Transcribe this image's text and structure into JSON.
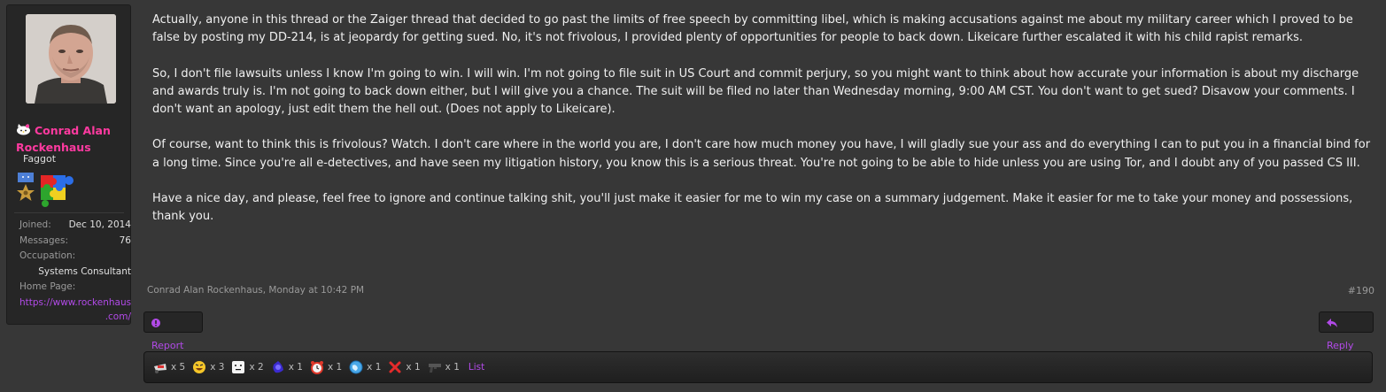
{
  "user": {
    "name": "Conrad Alan Rockenhaus",
    "title": "Faggot",
    "info": {
      "joined_label": "Joined:",
      "joined_value": "Dec 10, 2014",
      "messages_label": "Messages:",
      "messages_value": "76",
      "occupation_label": "Occupation:",
      "occupation_value": "Systems Consultant",
      "homepage_label": "Home Page:",
      "homepage_line1": "https://www.rockenhaus",
      "homepage_line2": ".com/"
    }
  },
  "message": {
    "paragraphs": [
      "Actually, anyone in this thread or the Zaiger thread that decided to go past the limits of free speech by committing libel, which is making accusations against me about my military career which I proved to be false by posting my DD-214, is at jeopardy for getting sued. No, it's not frivolous, I provided plenty of opportunities for people to back down. Likeicare further escalated it with his child rapist remarks.",
      "So, I don't file lawsuits unless I know I'm going to win. I will win. I'm not going to file suit in US Court and commit perjury, so you might want to think about how accurate your information is about my discharge and awards truly is. I'm not going to back down either, but I will give you a chance. The suit will be filed no later than Wednesday morning, 9:00 AM CST. You don't want to get sued? Disavow your comments. I don't want an apology, just edit them the hell out. (Does not apply to Likeicare).",
      "Of course, want to think this is frivolous? Watch. I don't care where in the world you are, I don't care how much money you have, I will gladly sue your ass and do everything I can to put you in a financial bind for a long time. Since you're all e-detectives, and have seen my litigation history, you know this is a serious threat. You're not going to be able to hide unless you are using Tor, and I doubt any of you passed CS III.",
      "Have a nice day, and please, feel free to ignore and continue talking shit, you'll just make it easier for me to win my case on a summary judgement. Make it easier for me to take your money and possessions, thank you."
    ]
  },
  "meta": {
    "author_date": "Conrad Alan Rockenhaus, Monday at 10:42 PM",
    "permalink": "#190"
  },
  "actions": {
    "report_label": "Report",
    "reply_label": "Reply"
  },
  "ratings": [
    {
      "icon": "autism-rating-icon",
      "count": "x 5"
    },
    {
      "icon": "laughing-face-icon",
      "count": "x 3"
    },
    {
      "icon": "neutral-face-icon",
      "count": "x 2"
    },
    {
      "icon": "purple-blob-icon",
      "count": "x 1"
    },
    {
      "icon": "alarm-clock-icon",
      "count": "x 1"
    },
    {
      "icon": "globe-icon",
      "count": "x 1"
    },
    {
      "icon": "red-x-icon",
      "count": "x 1"
    },
    {
      "icon": "gun-icon",
      "count": "x 1"
    }
  ],
  "ratings_list_label": "List",
  "colors": {
    "accent": "#b24ae8",
    "username": "#ff3aa0",
    "background": "#373737",
    "panel": "#262626"
  }
}
